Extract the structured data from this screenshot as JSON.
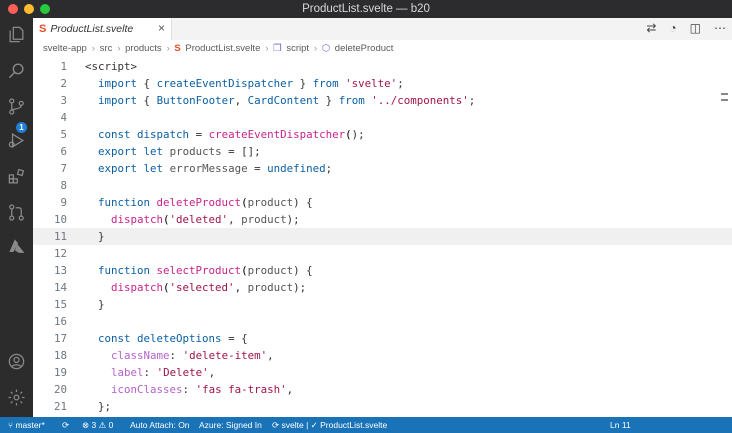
{
  "window": {
    "title": "ProductList.svelte — b20"
  },
  "tab": {
    "label": "ProductList.svelte",
    "close": "×"
  },
  "activity": {
    "badge_count": "1"
  },
  "breadcrumbs": [
    "svelte-app",
    "src",
    "products",
    "ProductList.svelte",
    "script",
    "deleteProduct"
  ],
  "code_lines": [
    {
      "n": "1",
      "t": "<script>"
    },
    {
      "n": "2",
      "t": "  import { createEventDispatcher } from 'svelte';"
    },
    {
      "n": "3",
      "t": "  import { ButtonFooter, CardContent } from '../components';"
    },
    {
      "n": "4",
      "t": ""
    },
    {
      "n": "5",
      "t": "  const dispatch = createEventDispatcher();"
    },
    {
      "n": "6",
      "t": "  export let products = [];"
    },
    {
      "n": "7",
      "t": "  export let errorMessage = undefined;"
    },
    {
      "n": "8",
      "t": ""
    },
    {
      "n": "9",
      "t": "  function deleteProduct(product) {"
    },
    {
      "n": "10",
      "t": "    dispatch('deleted', product);"
    },
    {
      "n": "11",
      "t": "  }"
    },
    {
      "n": "12",
      "t": ""
    },
    {
      "n": "13",
      "t": "  function selectProduct(product) {"
    },
    {
      "n": "14",
      "t": "    dispatch('selected', product);"
    },
    {
      "n": "15",
      "t": "  }"
    },
    {
      "n": "16",
      "t": ""
    },
    {
      "n": "17",
      "t": "  const deleteOptions = {"
    },
    {
      "n": "18",
      "t": "    className: 'delete-item',"
    },
    {
      "n": "19",
      "t": "    label: 'Delete',"
    },
    {
      "n": "20",
      "t": "    iconClasses: 'fas fa-trash',"
    },
    {
      "n": "21",
      "t": "  };"
    }
  ],
  "status": {
    "branch": "master*",
    "errors": "3",
    "warnings": "0",
    "auto_attach": "Auto Attach: On",
    "azure": "Azure: Signed In",
    "language": "svelte",
    "file": "ProductList.svelte",
    "position": "Ln 11"
  },
  "colors": {
    "accent": "#1a73b7",
    "keyword": "#0b5fa3",
    "function": "#c8238b",
    "string": "#a0144a"
  }
}
